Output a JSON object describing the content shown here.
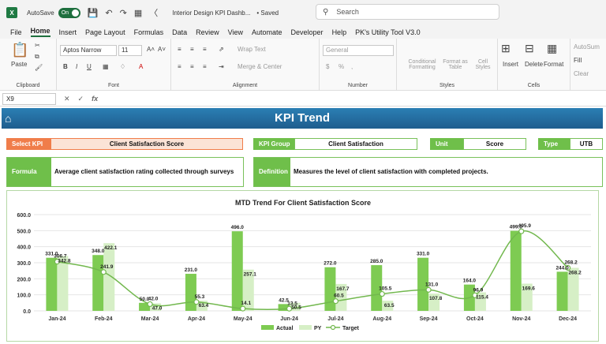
{
  "titlebar": {
    "autosave_label": "AutoSave",
    "toggle_label": "On",
    "doc_title": "Interior Design KPI Dashb...",
    "saved_label": "• Saved",
    "search_placeholder": "Search"
  },
  "menu": [
    "File",
    "Home",
    "Insert",
    "Page Layout",
    "Formulas",
    "Data",
    "Review",
    "View",
    "Automate",
    "Developer",
    "Help",
    "PK's Utility Tool V3.0"
  ],
  "ribbon": {
    "clipboard_label": "Clipboard",
    "paste_label": "Paste",
    "font_label": "Font",
    "font_name": "Aptos Narrow",
    "font_size": "11",
    "alignment_label": "Alignment",
    "wrap_text": "Wrap Text",
    "merge_center": "Merge & Center",
    "number_label": "Number",
    "number_format": "General",
    "styles_label": "Styles",
    "conditional_formatting": "Conditional Formatting",
    "format_as_table": "Format as Table",
    "cell_styles": "Cell Styles",
    "cells_label": "Cells",
    "insert": "Insert",
    "delete": "Delete",
    "format": "Format",
    "autosum": "AutoSum",
    "fill": "Fill",
    "clear": "Clear"
  },
  "formula_bar": {
    "name_box": "X9",
    "fx": "fx"
  },
  "dashboard": {
    "title": "KPI Trend",
    "select_kpi_label": "Select KPI",
    "select_kpi_value": "Client Satisfaction Score",
    "kpi_group_label": "KPI Group",
    "kpi_group_value": "Client Satisfaction",
    "unit_label": "Unit",
    "unit_value": "Score",
    "type_label": "Type",
    "type_value": "UTB",
    "formula_label": "Formula",
    "formula_value": "Average client satisfaction rating collected through surveys",
    "definition_label": "Definition",
    "definition_value": "Measures the level of client satisfaction with completed projects."
  },
  "colors": {
    "actual": "#7ecb52",
    "py": "#d6efc6",
    "target": "#72b84e",
    "header": "#2474a8",
    "select_kpi": "#f07d4a"
  },
  "chart_data": {
    "type": "bar",
    "title": "MTD Trend For Client Satisfaction Score",
    "categories": [
      "Jan-24",
      "Feb-24",
      "Mar-24",
      "Apr-24",
      "May-24",
      "Jun-24",
      "Jul-24",
      "Aug-24",
      "Sep-24",
      "Oct-24",
      "Nov-24",
      "Dec-24"
    ],
    "ylim": [
      0,
      600
    ],
    "yticks": [
      "0.0",
      "100.0",
      "200.0",
      "300.0",
      "400.0",
      "500.0",
      "600.0"
    ],
    "series": [
      {
        "name": "Actual",
        "type": "bar",
        "values": [
          331.0,
          348.0,
          50.0,
          231.0,
          496.0,
          42.5,
          272.0,
          285.0,
          331.0,
          164.0,
          499.0,
          244.0
        ]
      },
      {
        "name": "PY",
        "type": "bar",
        "values": [
          342.8,
          422.1,
          47.0,
          63.4,
          257.1,
          50.5,
          167.7,
          63.5,
          107.8,
          115.4,
          169.6,
          268.2
        ]
      },
      {
        "name": "Target",
        "type": "line",
        "values": [
          306.7,
          241.9,
          42.0,
          55.3,
          14.1,
          13.5,
          60.5,
          105.5,
          131.0,
          96.9,
          495.9,
          268.2
        ]
      }
    ],
    "legend": "bottom"
  }
}
